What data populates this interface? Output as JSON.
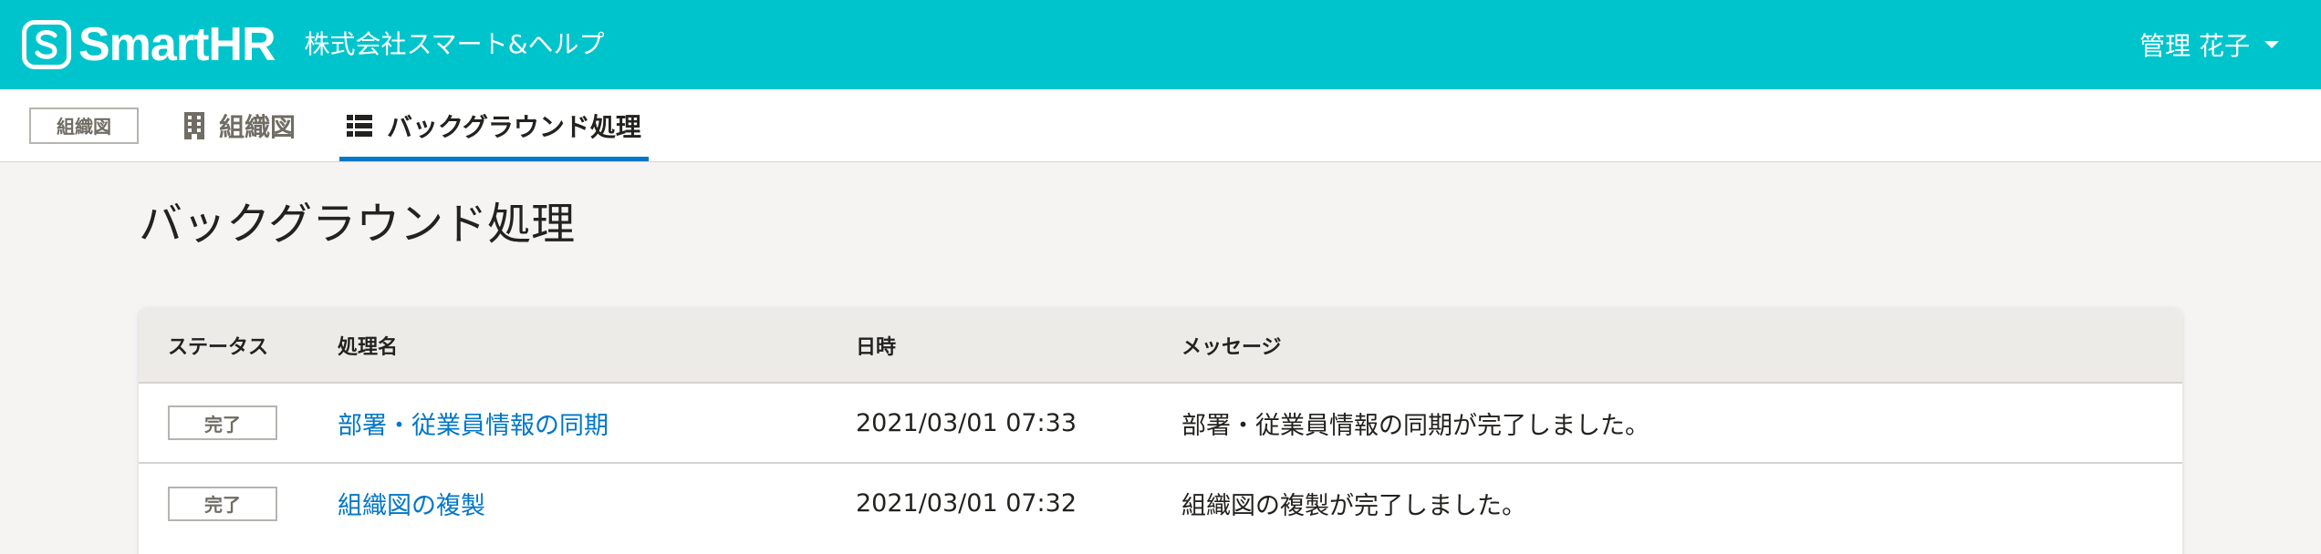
{
  "header": {
    "logo_text": "SmartHR",
    "company_name": "株式会社スマート&ヘルプ",
    "user_name": "管理 花子",
    "background_color": "#00c4cc"
  },
  "subnav": {
    "badge_label": "組織図",
    "tabs": [
      {
        "label": "組織図",
        "icon": "building-icon",
        "active": false
      },
      {
        "label": "バックグラウンド処理",
        "icon": "list-icon",
        "active": true
      }
    ],
    "active_color": "#0077c7"
  },
  "page": {
    "title": "バックグラウンド処理"
  },
  "table": {
    "headers": {
      "status": "ステータス",
      "name": "処理名",
      "datetime": "日時",
      "message": "メッセージ"
    },
    "rows": [
      {
        "status": "完了",
        "name": "部署・従業員情報の同期",
        "datetime": "2021/03/01 07:33",
        "message": "部署・従業員情報の同期が完了しました。"
      },
      {
        "status": "完了",
        "name": "組織図の複製",
        "datetime": "2021/03/01 07:32",
        "message": "組織図の複製が完了しました。"
      }
    ]
  }
}
